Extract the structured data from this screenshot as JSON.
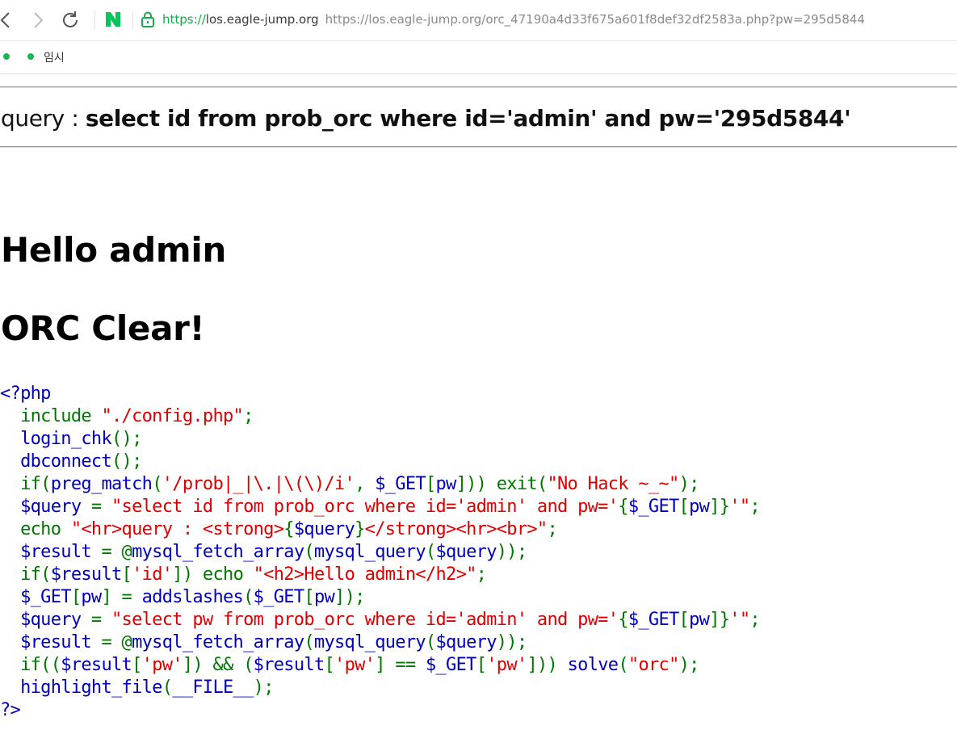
{
  "browser": {
    "url_scheme": "https://",
    "url_host": "los.eagle-jump.org",
    "url_full": "https://los.eagle-jump.org/orc_47190a4d33f675a601f8def32df2583a.php?pw=295d5844",
    "bookmark_label": "임시",
    "colors": {
      "secure": "#19a84b",
      "naver": "#03c75a"
    }
  },
  "page": {
    "query_prefix": "query : ",
    "query_text": "select id from prob_orc where id='admin' and pw='295d5844'",
    "hello": "Hello admin",
    "clear": "ORC Clear!"
  },
  "source_code": [
    [
      {
        "c": "d",
        "t": "<?php"
      }
    ],
    [
      {
        "c": "k",
        "t": "  include "
      },
      {
        "c": "s",
        "t": "\"./config.php\""
      },
      {
        "c": "k",
        "t": ";"
      }
    ],
    [
      {
        "c": "d",
        "t": "  login_chk"
      },
      {
        "c": "k",
        "t": "();"
      }
    ],
    [
      {
        "c": "d",
        "t": "  dbconnect"
      },
      {
        "c": "k",
        "t": "();"
      }
    ],
    [
      {
        "c": "k",
        "t": "  if("
      },
      {
        "c": "d",
        "t": "preg_match"
      },
      {
        "c": "k",
        "t": "("
      },
      {
        "c": "s",
        "t": "'/prob|_|\\.|\\(\\)/i'"
      },
      {
        "c": "k",
        "t": ", "
      },
      {
        "c": "d",
        "t": "$_GET"
      },
      {
        "c": "k",
        "t": "["
      },
      {
        "c": "d",
        "t": "pw"
      },
      {
        "c": "k",
        "t": "])) exit("
      },
      {
        "c": "s",
        "t": "\"No Hack ~_~\""
      },
      {
        "c": "k",
        "t": ");"
      }
    ],
    [
      {
        "c": "d",
        "t": "  $query "
      },
      {
        "c": "k",
        "t": "= "
      },
      {
        "c": "s",
        "t": "\"select id from prob_orc where id='admin' and pw='"
      },
      {
        "c": "k",
        "t": "{"
      },
      {
        "c": "d",
        "t": "$_GET"
      },
      {
        "c": "k",
        "t": "["
      },
      {
        "c": "d",
        "t": "pw"
      },
      {
        "c": "k",
        "t": "]}"
      },
      {
        "c": "s",
        "t": "'\""
      },
      {
        "c": "k",
        "t": ";"
      }
    ],
    [
      {
        "c": "k",
        "t": "  echo "
      },
      {
        "c": "s",
        "t": "\"<hr>query : <strong>"
      },
      {
        "c": "k",
        "t": "{"
      },
      {
        "c": "d",
        "t": "$query"
      },
      {
        "c": "k",
        "t": "}"
      },
      {
        "c": "s",
        "t": "</strong><hr><br>\""
      },
      {
        "c": "k",
        "t": ";"
      }
    ],
    [
      {
        "c": "d",
        "t": "  $result "
      },
      {
        "c": "k",
        "t": "= @"
      },
      {
        "c": "d",
        "t": "mysql_fetch_array"
      },
      {
        "c": "k",
        "t": "("
      },
      {
        "c": "d",
        "t": "mysql_query"
      },
      {
        "c": "k",
        "t": "("
      },
      {
        "c": "d",
        "t": "$query"
      },
      {
        "c": "k",
        "t": "));"
      }
    ],
    [
      {
        "c": "k",
        "t": "  if("
      },
      {
        "c": "d",
        "t": "$result"
      },
      {
        "c": "k",
        "t": "["
      },
      {
        "c": "s",
        "t": "'id'"
      },
      {
        "c": "k",
        "t": "]) echo "
      },
      {
        "c": "s",
        "t": "\"<h2>Hello admin</h2>\""
      },
      {
        "c": "k",
        "t": ";"
      }
    ],
    [
      {
        "c": "d",
        "t": "  $_GET"
      },
      {
        "c": "k",
        "t": "["
      },
      {
        "c": "d",
        "t": "pw"
      },
      {
        "c": "k",
        "t": "] = "
      },
      {
        "c": "d",
        "t": "addslashes"
      },
      {
        "c": "k",
        "t": "("
      },
      {
        "c": "d",
        "t": "$_GET"
      },
      {
        "c": "k",
        "t": "["
      },
      {
        "c": "d",
        "t": "pw"
      },
      {
        "c": "k",
        "t": "]);"
      }
    ],
    [
      {
        "c": "d",
        "t": "  $query "
      },
      {
        "c": "k",
        "t": "= "
      },
      {
        "c": "s",
        "t": "\"select pw from prob_orc where id='admin' and pw='"
      },
      {
        "c": "k",
        "t": "{"
      },
      {
        "c": "d",
        "t": "$_GET"
      },
      {
        "c": "k",
        "t": "["
      },
      {
        "c": "d",
        "t": "pw"
      },
      {
        "c": "k",
        "t": "]}"
      },
      {
        "c": "s",
        "t": "'\""
      },
      {
        "c": "k",
        "t": ";"
      }
    ],
    [
      {
        "c": "d",
        "t": "  $result "
      },
      {
        "c": "k",
        "t": "= @"
      },
      {
        "c": "d",
        "t": "mysql_fetch_array"
      },
      {
        "c": "k",
        "t": "("
      },
      {
        "c": "d",
        "t": "mysql_query"
      },
      {
        "c": "k",
        "t": "("
      },
      {
        "c": "d",
        "t": "$query"
      },
      {
        "c": "k",
        "t": "));"
      }
    ],
    [
      {
        "c": "k",
        "t": "  if(("
      },
      {
        "c": "d",
        "t": "$result"
      },
      {
        "c": "k",
        "t": "["
      },
      {
        "c": "s",
        "t": "'pw'"
      },
      {
        "c": "k",
        "t": "]) && ("
      },
      {
        "c": "d",
        "t": "$result"
      },
      {
        "c": "k",
        "t": "["
      },
      {
        "c": "s",
        "t": "'pw'"
      },
      {
        "c": "k",
        "t": "] == "
      },
      {
        "c": "d",
        "t": "$_GET"
      },
      {
        "c": "k",
        "t": "["
      },
      {
        "c": "s",
        "t": "'pw'"
      },
      {
        "c": "k",
        "t": "])) "
      },
      {
        "c": "d",
        "t": "solve"
      },
      {
        "c": "k",
        "t": "("
      },
      {
        "c": "s",
        "t": "\"orc\""
      },
      {
        "c": "k",
        "t": ");"
      }
    ],
    [
      {
        "c": "d",
        "t": "  highlight_file"
      },
      {
        "c": "k",
        "t": "("
      },
      {
        "c": "d",
        "t": "__FILE__"
      },
      {
        "c": "k",
        "t": ");"
      }
    ],
    [
      {
        "c": "d",
        "t": "?>"
      }
    ]
  ]
}
